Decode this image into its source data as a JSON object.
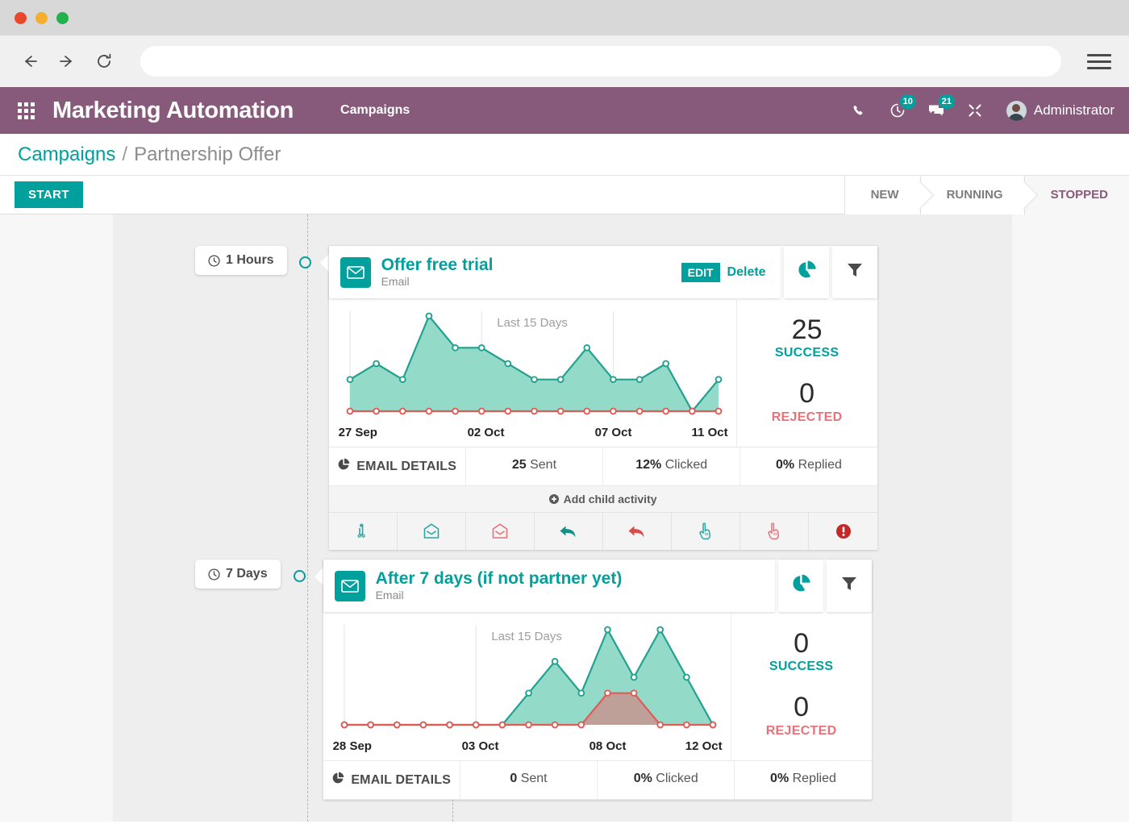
{
  "browser": {
    "back_icon": "back-arrow-icon",
    "forward_icon": "forward-arrow-icon",
    "reload_icon": "reload-icon",
    "url_value": "",
    "url_placeholder": "",
    "menu_icon": "hamburger-menu-icon"
  },
  "appbar": {
    "apps_icon": "apps-grid-icon",
    "title": "Marketing Automation",
    "menu_item": "Campaigns",
    "phone_icon": "phone-icon",
    "activity_icon": "clock-activity-icon",
    "activity_count": "10",
    "messages_icon": "messages-icon",
    "messages_count": "21",
    "tools_icon": "tools-icon",
    "user_name": "Administrator",
    "brand_purple": "#875A7B",
    "accent_teal": "#00a09d"
  },
  "breadcrumb": {
    "parent": "Campaigns",
    "separator": "/",
    "current": "Partnership Offer"
  },
  "controlbar": {
    "start_label": "START",
    "statuses": [
      {
        "label": "NEW",
        "active": false
      },
      {
        "label": "RUNNING",
        "active": false
      },
      {
        "label": "STOPPED",
        "active": true
      }
    ]
  },
  "activities": [
    {
      "delay": "1 Hours",
      "title": "Offer free trial",
      "subtitle": "Email",
      "edit_label": "EDIT",
      "delete_label": "Delete",
      "pie_icon": "pie-chart-icon",
      "filter_icon": "funnel-filter-icon",
      "caption": "Last 15 Days",
      "success_value": "25",
      "success_label": "SUCCESS",
      "rejected_value": "0",
      "rejected_label": "REJECTED",
      "details_label": "EMAIL DETAILS",
      "sent_value": "25",
      "sent_label": "Sent",
      "clicked_value": "12%",
      "clicked_label": "Clicked",
      "replied_value": "0%",
      "replied_label": "Replied",
      "add_child_label": "Add child activity",
      "has_child_row": true,
      "child_icons": [
        "sent-icon",
        "opened-mail-icon",
        "not-opened-mail-icon",
        "replied-icon",
        "not-replied-icon",
        "clicked-icon",
        "not-clicked-icon",
        "bounced-icon"
      ]
    },
    {
      "delay": "7 Days",
      "title": "After 7 days (if not partner yet)",
      "subtitle": "Email",
      "pie_icon": "pie-chart-icon",
      "filter_icon": "funnel-filter-icon",
      "caption": "Last 15 Days",
      "success_value": "0",
      "success_label": "SUCCESS",
      "rejected_value": "0",
      "rejected_label": "REJECTED",
      "details_label": "EMAIL DETAILS",
      "sent_value": "0",
      "sent_label": "Sent",
      "clicked_value": "0%",
      "clicked_label": "Clicked",
      "replied_value": "0%",
      "replied_label": "Replied",
      "has_child_row": false
    }
  ],
  "chart_data": [
    {
      "type": "area",
      "title": "Last 15 Days",
      "chart_index": 0,
      "x": [
        "27 Sep",
        "28 Sep",
        "29 Sep",
        "30 Sep",
        "01 Oct",
        "02 Oct",
        "03 Oct",
        "04 Oct",
        "05 Oct",
        "06 Oct",
        "07 Oct",
        "08 Oct",
        "09 Oct",
        "10 Oct",
        "11 Oct"
      ],
      "tick_labels": [
        {
          "index": 0,
          "label": "27 Sep"
        },
        {
          "index": 5,
          "label": "02 Oct"
        },
        {
          "index": 10,
          "label": "07 Oct"
        },
        {
          "index": 14,
          "label": "11 Oct"
        }
      ],
      "ylim": [
        0,
        6
      ],
      "grid": "vertical-light",
      "series": [
        {
          "name": "Success",
          "color": "#21a18f",
          "fill": "#94dac9",
          "values": [
            2,
            3,
            2,
            6,
            4,
            4,
            3,
            2,
            2,
            4,
            2,
            2,
            3,
            0,
            2
          ]
        },
        {
          "name": "Rejected",
          "color": "#e15b56",
          "fill": "none",
          "values": [
            0,
            0,
            0,
            0,
            0,
            0,
            0,
            0,
            0,
            0,
            0,
            0,
            0,
            0,
            0
          ]
        }
      ]
    },
    {
      "type": "area",
      "title": "Last 15 Days",
      "chart_index": 1,
      "x": [
        "28 Sep",
        "29 Sep",
        "30 Sep",
        "01 Oct",
        "02 Oct",
        "03 Oct",
        "04 Oct",
        "05 Oct",
        "06 Oct",
        "07 Oct",
        "08 Oct",
        "09 Oct",
        "10 Oct",
        "11 Oct",
        "12 Oct"
      ],
      "tick_labels": [
        {
          "index": 0,
          "label": "28 Sep"
        },
        {
          "index": 5,
          "label": "03 Oct"
        },
        {
          "index": 10,
          "label": "08 Oct"
        },
        {
          "index": 14,
          "label": "12 Oct"
        }
      ],
      "ylim": [
        0,
        6
      ],
      "grid": "vertical-light",
      "series": [
        {
          "name": "Success",
          "color": "#21a18f",
          "fill": "#94dac9",
          "values": [
            0,
            0,
            0,
            0,
            0,
            0,
            0,
            2,
            4,
            2,
            6,
            3,
            6,
            3,
            0
          ]
        },
        {
          "name": "Rejected",
          "color": "#e15b56",
          "fill": "#c79590",
          "values": [
            0,
            0,
            0,
            0,
            0,
            0,
            0,
            0,
            0,
            0,
            2,
            2,
            0,
            0,
            0
          ]
        }
      ]
    }
  ]
}
